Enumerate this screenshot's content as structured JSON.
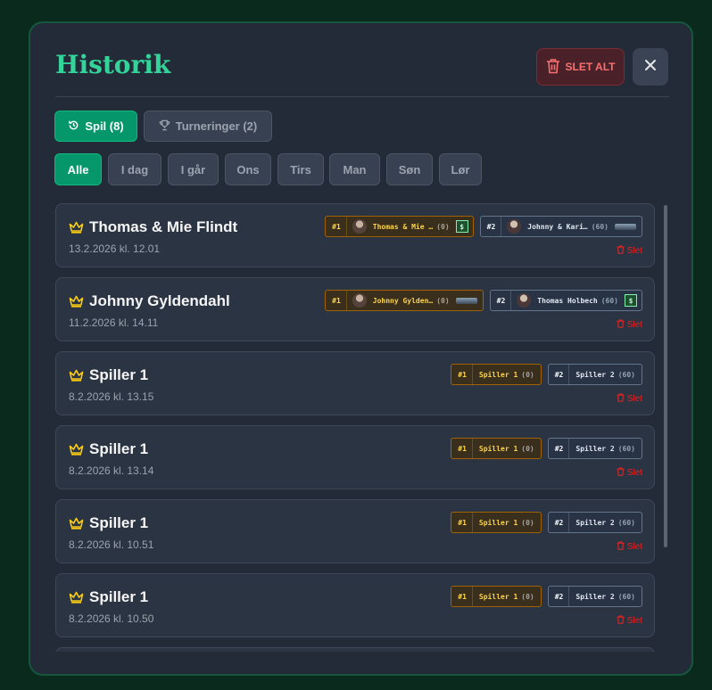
{
  "header": {
    "title": "Historik",
    "delete_all_label": "SLET ALT"
  },
  "tabs": [
    {
      "label": "Spil (8)",
      "active": true,
      "icon": "history-icon"
    },
    {
      "label": "Turneringer (2)",
      "active": false,
      "icon": "trophy-icon"
    }
  ],
  "day_filters": [
    "Alle",
    "I dag",
    "I går",
    "Ons",
    "Tirs",
    "Man",
    "Søn",
    "Lør"
  ],
  "active_day": "Alle",
  "games": [
    {
      "winner": "Thomas & Mie Flindt",
      "date": "13.2.2026 kl. 12.01",
      "delete_label": "Slet",
      "players": [
        {
          "rank": "#1",
          "name": "Thomas & Mie …",
          "score": "(0)",
          "style": "gold",
          "avatar": true,
          "badge": "money-icon"
        },
        {
          "rank": "#2",
          "name": "Johnny & Kari…",
          "score": "(60)",
          "style": "blue",
          "avatar": true,
          "badge": "plate-icon"
        }
      ]
    },
    {
      "winner": "Johnny Gyldendahl",
      "date": "11.2.2026 kl. 14.11",
      "delete_label": "Slet",
      "players": [
        {
          "rank": "#1",
          "name": "Johnny Gylden…",
          "score": "(0)",
          "style": "gold",
          "avatar": true,
          "badge": "plate-icon"
        },
        {
          "rank": "#2",
          "name": "Thomas Holbech",
          "score": "(60)",
          "style": "blue",
          "avatar": true,
          "badge": "money-icon"
        }
      ]
    },
    {
      "winner": "Spiller 1",
      "date": "8.2.2026 kl. 13.15",
      "delete_label": "Slet",
      "players": [
        {
          "rank": "#1",
          "name": "Spiller 1",
          "score": "(0)",
          "style": "gold",
          "avatar": false,
          "badge": ""
        },
        {
          "rank": "#2",
          "name": "Spiller 2",
          "score": "(60)",
          "style": "blue",
          "avatar": false,
          "badge": ""
        }
      ]
    },
    {
      "winner": "Spiller 1",
      "date": "8.2.2026 kl. 13.14",
      "delete_label": "Slet",
      "players": [
        {
          "rank": "#1",
          "name": "Spiller 1",
          "score": "(0)",
          "style": "gold",
          "avatar": false,
          "badge": ""
        },
        {
          "rank": "#2",
          "name": "Spiller 2",
          "score": "(60)",
          "style": "blue",
          "avatar": false,
          "badge": ""
        }
      ]
    },
    {
      "winner": "Spiller 1",
      "date": "8.2.2026 kl. 10.51",
      "delete_label": "Slet",
      "players": [
        {
          "rank": "#1",
          "name": "Spiller 1",
          "score": "(0)",
          "style": "gold",
          "avatar": false,
          "badge": ""
        },
        {
          "rank": "#2",
          "name": "Spiller 2",
          "score": "(60)",
          "style": "blue",
          "avatar": false,
          "badge": ""
        }
      ]
    },
    {
      "winner": "Spiller 1",
      "date": "8.2.2026 kl. 10.50",
      "delete_label": "Slet",
      "players": [
        {
          "rank": "#1",
          "name": "Spiller 1",
          "score": "(0)",
          "style": "gold",
          "avatar": false,
          "badge": ""
        },
        {
          "rank": "#2",
          "name": "Spiller 2",
          "score": "(60)",
          "style": "blue",
          "avatar": false,
          "badge": ""
        }
      ]
    }
  ],
  "colors": {
    "accent": "#34d399",
    "active": "#059669",
    "danger": "#f87171",
    "crown": "#facc15"
  }
}
